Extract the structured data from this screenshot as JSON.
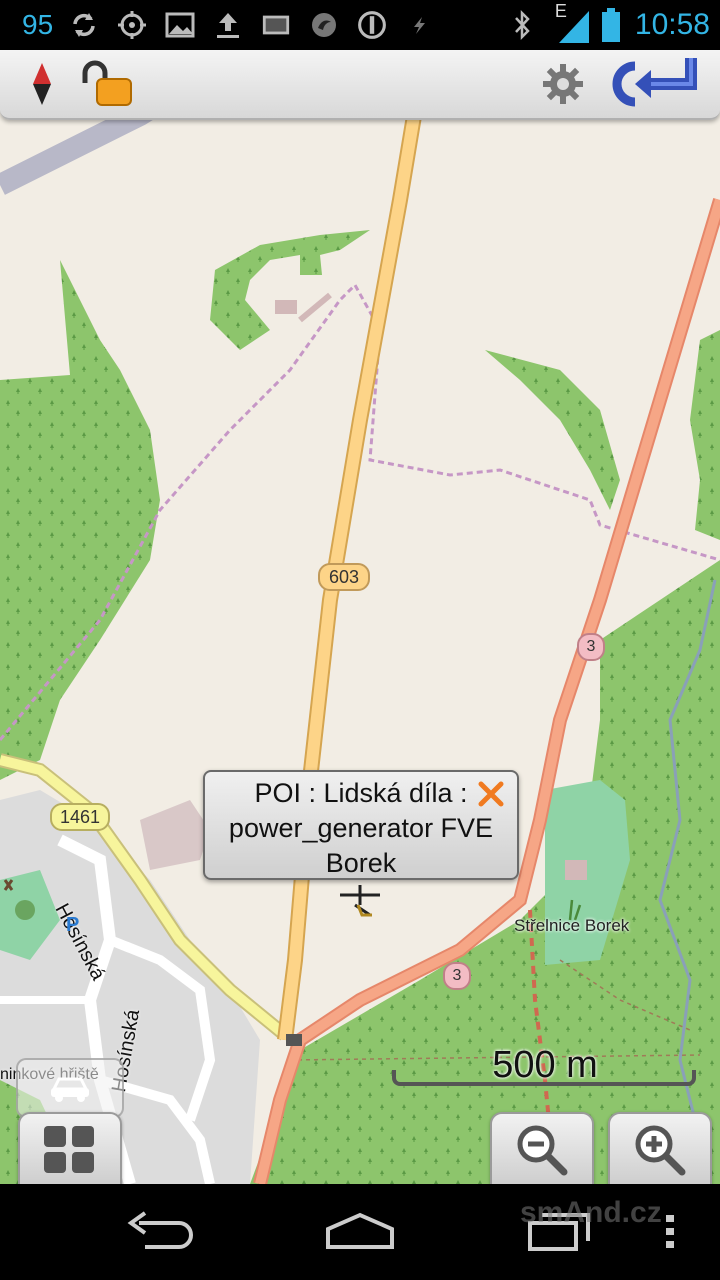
{
  "status_bar": {
    "notification_count": "95",
    "network_type": "E",
    "time": "10:58",
    "icons": [
      "sync-icon",
      "gps-icon",
      "gallery-icon",
      "upload-icon",
      "screen-icon",
      "app-icon",
      "power-icon",
      "bolt-icon",
      "bluetooth-icon",
      "signal-icon",
      "battery-icon"
    ]
  },
  "toolbar": {
    "compass": "compass-icon",
    "lock": "lock-open-icon",
    "settings": "gear-icon",
    "back": "back-to-location-icon"
  },
  "map": {
    "road_label_603": "603",
    "road_label_1461": "1461",
    "road_label_3a": "3",
    "road_label_3b": "3",
    "street_hosinska_1": "Hosínská",
    "street_hosinska_2": "Hosínská",
    "place_strelnice": "Střelnice Borek",
    "place_hriste": "ninkové hřiště",
    "parking": "P",
    "colors": {
      "background": "#f2ede4",
      "forest": "#8dc56c",
      "primary_road": "#fdd488",
      "secondary_road": "#f6a686",
      "residential": "#dcdcdc",
      "park": "#8fd3a6"
    }
  },
  "popup": {
    "line1": "POI : Lidská díla :",
    "line2": "power_generator FVE",
    "line3": "Borek"
  },
  "scale": {
    "label": "500 m"
  },
  "controls": {
    "menu": "grid-menu-icon",
    "zoom_out": "zoom-out-icon",
    "zoom_in": "zoom-in-icon",
    "car": "car-icon"
  },
  "nav_bar": {
    "back": "back-icon",
    "home": "home-icon",
    "recent": "recent-apps-icon",
    "overflow": "overflow-menu-icon"
  },
  "watermark": "smAnd.cz"
}
